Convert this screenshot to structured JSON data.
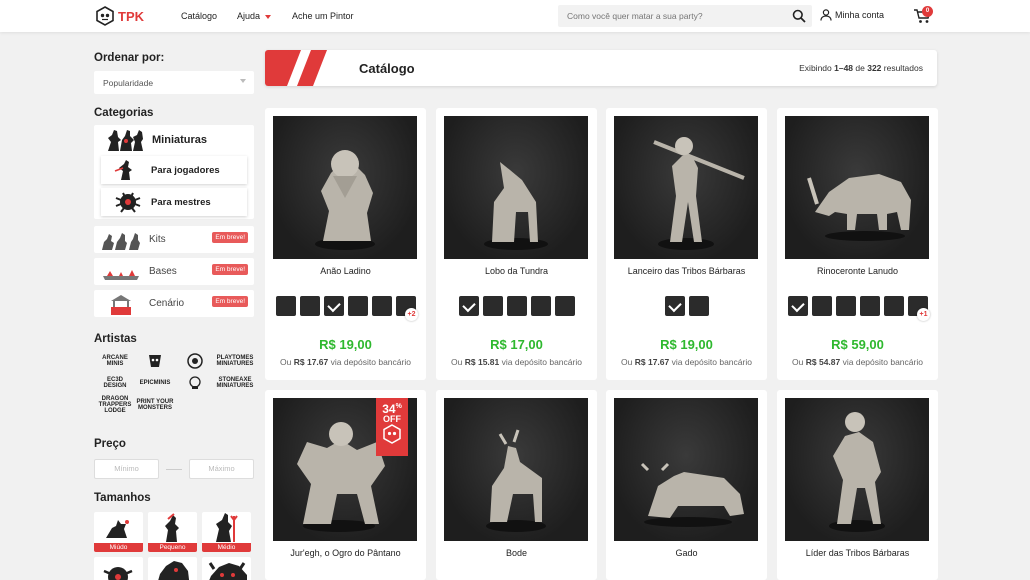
{
  "header": {
    "brand": "TPK",
    "nav": [
      "Catálogo",
      "Ajuda",
      "Ache um Pintor"
    ],
    "search_placeholder": "Como você quer matar a sua party?",
    "account": "Minha conta",
    "cart_count": "0"
  },
  "sidebar": {
    "order_title": "Ordenar por:",
    "order_value": "Popularidade",
    "categories_title": "Categorias",
    "main_category": "Miniaturas",
    "subcategories": [
      "Para jogadores",
      "Para mestres"
    ],
    "other_categories": [
      {
        "label": "Kits",
        "badge": "Em breve!"
      },
      {
        "label": "Bases",
        "badge": "Em breve!"
      },
      {
        "label": "Cenário",
        "badge": "Em breve!"
      }
    ],
    "artists_title": "Artistas",
    "artists": [
      "ARCANE MINIS",
      "",
      "",
      "PLAYTOMES MINIATURES",
      "EC3D DESIGN",
      "EPICMINIS",
      "",
      "STONEAXE MINIATURES",
      "DRAGON TRAPPERS LODGE",
      "PRINT YOUR MONSTERS"
    ],
    "price_title": "Preço",
    "price_min": "Mínimo",
    "price_max": "Máximo",
    "sizes_title": "Tamanhos",
    "sizes": [
      "Miúdo",
      "Pequeno",
      "Médio"
    ]
  },
  "catalog": {
    "title": "Catálogo",
    "results_prefix": "Exibindo ",
    "results_range": "1–48",
    "results_mid": " de ",
    "results_total": "322",
    "results_suffix": " resultados"
  },
  "products": [
    {
      "name": "Anão Ladino",
      "price": "R$ 19,00",
      "bank_prefix": "Ou ",
      "bank_price": "R$ 17.67",
      "bank_suffix": " via depósito bancário",
      "more": "+2"
    },
    {
      "name": "Lobo da Tundra",
      "price": "R$ 17,00",
      "bank_prefix": "Ou ",
      "bank_price": "R$ 15.81",
      "bank_suffix": " via depósito bancário"
    },
    {
      "name": "Lanceiro das Tribos Bárbaras",
      "price": "R$ 19,00",
      "bank_prefix": "Ou ",
      "bank_price": "R$ 17.67",
      "bank_suffix": " via depósito bancário"
    },
    {
      "name": "Rinoceronte Lanudo",
      "price": "R$ 59,00",
      "bank_prefix": "Ou ",
      "bank_price": "R$ 54.87",
      "bank_suffix": " via depósito bancário",
      "more": "+1"
    },
    {
      "name": "Jur'egh, o Ogro do Pântano",
      "discount": "34",
      "discount_unit": "%",
      "discount_label": "OFF"
    },
    {
      "name": "Bode"
    },
    {
      "name": "Gado"
    },
    {
      "name": "Líder das Tribos Bárbaras"
    }
  ],
  "colors": {
    "accent": "#e03a3a",
    "price": "#2eb82e"
  }
}
